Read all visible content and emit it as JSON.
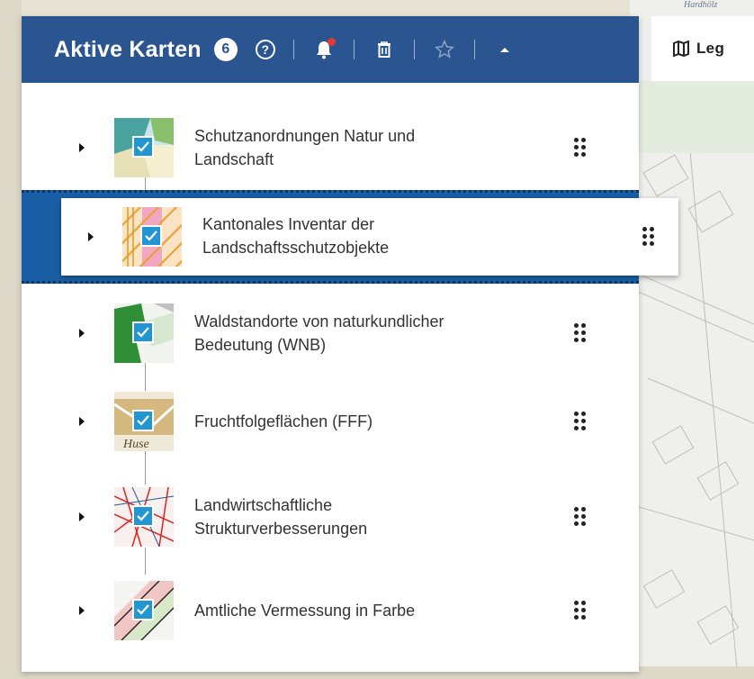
{
  "map": {
    "place_label": "Hardhölz"
  },
  "legend_tab": {
    "label": "Leg",
    "icon": "map-icon"
  },
  "panel": {
    "title": "Aktive Karten",
    "count": "6",
    "header_icons": [
      "help-icon",
      "bell-icon",
      "trash-icon",
      "star-icon",
      "chevron-up-icon"
    ],
    "notification_dot_color": "#e53935",
    "accent_color": "#2a5590"
  },
  "layers": [
    {
      "label_line1": "Schutzanordnungen Natur und",
      "label_line2": "Landschaft",
      "checked": true
    },
    {
      "label_line1": "Kantonales Inventar der",
      "label_line2": "Landschaftsschutzobjekte",
      "checked": true,
      "dragging": true
    },
    {
      "label_line1": "Waldstandorte von naturkundlicher",
      "label_line2": "Bedeutung (WNB)",
      "checked": true
    },
    {
      "label_line1": "Fruchtfolgeflächen (FFF)",
      "label_line2": "",
      "checked": true
    },
    {
      "label_line1": "Landwirtschaftliche",
      "label_line2": "Strukturverbesserungen",
      "checked": true
    },
    {
      "label_line1": "Amtliche Vermessung in Farbe",
      "label_line2": "",
      "checked": true
    }
  ]
}
